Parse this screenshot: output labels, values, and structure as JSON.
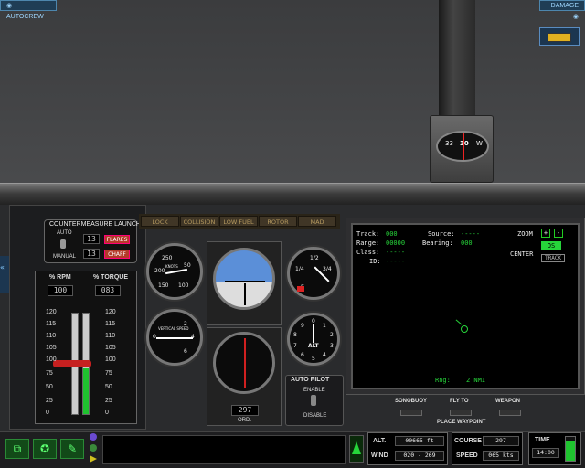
{
  "top": {
    "autocrew": "AUTOCREW",
    "damage": "DAMAGE"
  },
  "compass": {
    "labels": [
      "33",
      "30",
      "W"
    ]
  },
  "countermeasure": {
    "title": "COUNTERMEASURE LAUNCH",
    "auto": "AUTO",
    "manual": "MANUAL",
    "flares_count": "13",
    "chaff_count": "13",
    "flares_label": "FLARES",
    "chaff_label": "CHAFF"
  },
  "warnings": [
    "LOCK",
    "COLLISION",
    "LOW FUEL",
    "ROTOR",
    "MAD"
  ],
  "engine": {
    "rpm_label": "% RPM",
    "torque_label": "% TORQUE",
    "rpm_value": "100",
    "torque_value": "083",
    "scale": [
      "120",
      "115",
      "110",
      "105",
      "100",
      "75",
      "50",
      "25",
      "0"
    ]
  },
  "airspeed": {
    "label": "KNOTS",
    "ticks": [
      "250",
      "200",
      "150",
      "100",
      "50"
    ]
  },
  "vsi": {
    "label": "VERTICAL SPEED",
    "ticks": [
      "0",
      "2",
      "4",
      "6"
    ]
  },
  "fuel": {
    "ticks": [
      "1/2",
      "1/4",
      "3/4",
      "E"
    ]
  },
  "altimeter": {
    "label": "ALT",
    "ticks": [
      "0",
      "1",
      "2",
      "3",
      "4",
      "5",
      "6",
      "7",
      "8",
      "9"
    ]
  },
  "heading": {
    "value": "297",
    "label": "ORD."
  },
  "autopilot": {
    "title": "AUTO PILOT",
    "enable": "ENABLE",
    "disable": "DISABLE"
  },
  "radar": {
    "track_label": "Track:",
    "track": "000",
    "range_label": "Range:",
    "range": "00000",
    "class_label": "Class:",
    "class": "-----",
    "id_label": "ID:",
    "id": "-----",
    "source_label": "Source:",
    "source": "-----",
    "bearing_label": "Bearing:",
    "bearing": "000",
    "zoom_label": "ZOOM",
    "zoom_plus": "+",
    "zoom_minus": "-",
    "center_label": "CENTER",
    "os_btn": "OS",
    "track_btn": "TRACK",
    "rng_label": "Rng:",
    "rng_value": "2 NMI"
  },
  "waypoint": {
    "sonobuoy": "SONOBUOY",
    "fly_to": "FLY TO",
    "weapon": "WEAPON",
    "place": "PLACE WAYPOINT"
  },
  "status": {
    "alt_label": "ALT.",
    "alt_value": "00665 ft",
    "wind_label": "WIND",
    "wind_value": "020 - 269",
    "course_label": "COURSE",
    "course_value": "297",
    "speed_label": "SPEED",
    "speed_value": "065 kts",
    "time_label": "TIME",
    "time_value": "14:00"
  },
  "colors": {
    "radar_green": "#26d43a",
    "warn_amber": "#b69a60",
    "flare_red": "#b43a2a"
  }
}
